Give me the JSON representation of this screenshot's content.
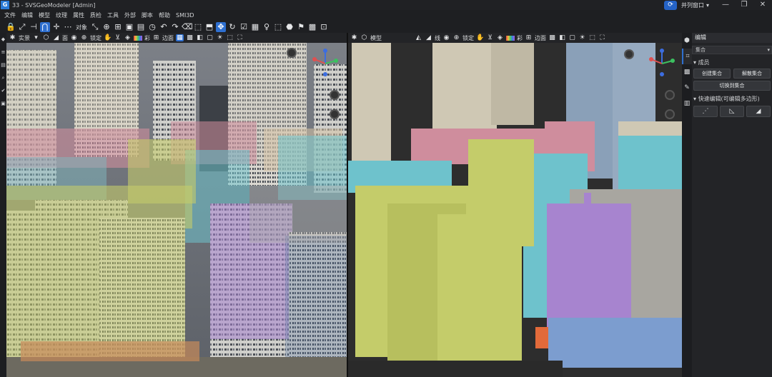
{
  "window": {
    "title": "33 - SVSGeoModeler [Admin]",
    "logo": "G",
    "sync_icon": "⟳",
    "layout_label": "并列窗口",
    "layout_caret": "▾",
    "min": "—",
    "max": "❐",
    "close": "✕"
  },
  "menu": [
    "文件",
    "编辑",
    "模型",
    "纹理",
    "属性",
    "质检",
    "工具",
    "外部",
    "脚本",
    "帮助",
    "SMI3D"
  ],
  "toolbar": {
    "object_label": "对象",
    "icons": [
      "🔒",
      "⤢",
      "⊣",
      "⋂",
      "✛",
      "⋯",
      "⤡",
      "⊕",
      "⊞",
      "▣",
      "▤",
      "◷",
      "↶",
      "↷",
      "⌫",
      "⬚",
      "⬒",
      "✥",
      "↻",
      "☑",
      "▦",
      "♀",
      "⬚",
      "⬣",
      "⚑",
      "▩",
      "⊡"
    ]
  },
  "left_viewport": {
    "mode_label": "实景",
    "lock_label": "锁定",
    "color_label": "彩",
    "edge_label": "边面"
  },
  "right_viewport": {
    "mode_label": "模型",
    "line_label": "线",
    "lock_label": "锁定",
    "color_label": "彩",
    "edge_label": "边面"
  },
  "right_panel": {
    "header": "编辑",
    "select_value": "集合",
    "section_members": "成员",
    "create_set": "创建集合",
    "dissolve_set": "解散集合",
    "switch_set": "切换到集合",
    "section_quick": "快速编辑(可编辑多边形)",
    "quick_icons": [
      "⋰",
      "◺",
      "◢"
    ]
  },
  "colors": {
    "accent": "#2e6fd0",
    "yellowgreen": "#c4cc6a",
    "pink": "#cf8d9d",
    "cyan": "#6ec2cc",
    "purple": "#a784cf",
    "beige": "#cfc8b4",
    "slate": "#8aa0b8",
    "blue": "#7c9dcf"
  }
}
